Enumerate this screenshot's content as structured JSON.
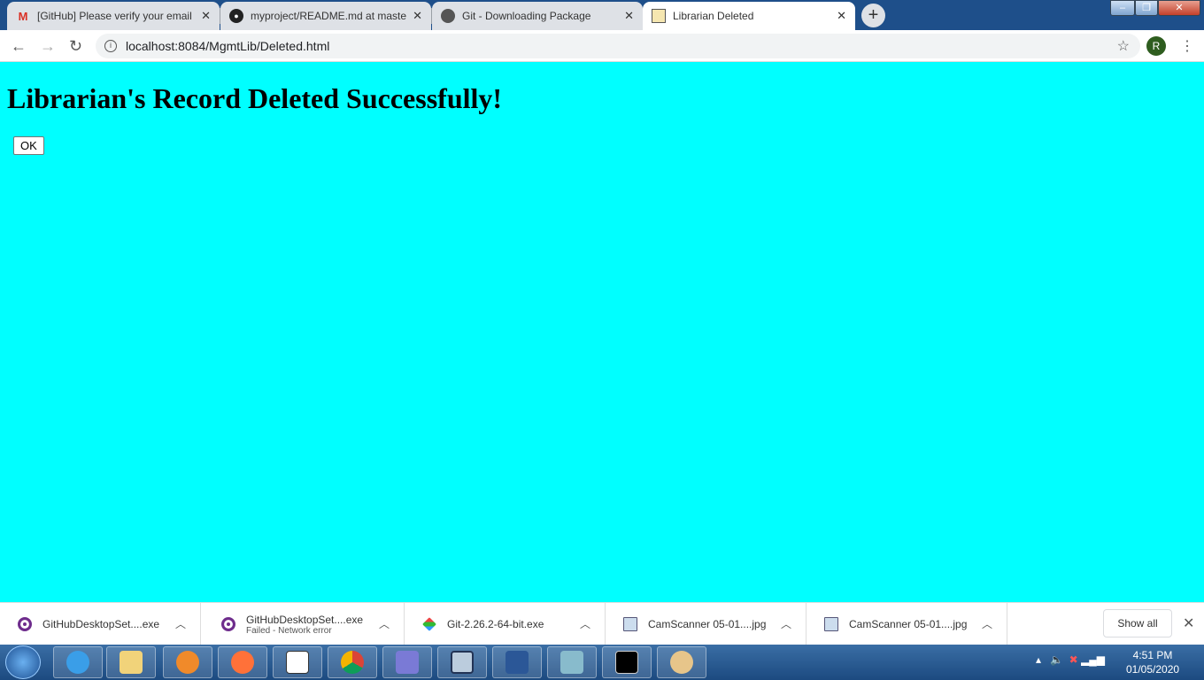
{
  "browser": {
    "tabs": [
      {
        "title": "[GitHub] Please verify your email",
        "icon": "gmail-icon",
        "active": false
      },
      {
        "title": "myproject/README.md at maste",
        "icon": "github-icon",
        "active": false
      },
      {
        "title": "Git - Downloading Package",
        "icon": "globe-icon",
        "active": false
      },
      {
        "title": "Librarian Deleted",
        "icon": "page-favicon-icon",
        "active": true
      }
    ],
    "url": "localhost:8084/MgmtLib/Deleted.html",
    "profile_initial": "R"
  },
  "page": {
    "heading": "Librarian's Record Deleted Successfully!",
    "ok_label": "OK",
    "background": "#00ffff"
  },
  "downloads": {
    "items": [
      {
        "name": "GitHubDesktopSet....exe",
        "status": "",
        "icon": "github-desktop-icon"
      },
      {
        "name": "GitHubDesktopSet....exe",
        "status": "Failed - Network error",
        "icon": "github-desktop-icon"
      },
      {
        "name": "Git-2.26.2-64-bit.exe",
        "status": "",
        "icon": "git-icon"
      },
      {
        "name": "CamScanner 05-01....jpg",
        "status": "",
        "icon": "image-file-icon"
      },
      {
        "name": "CamScanner 05-01....jpg",
        "status": "",
        "icon": "image-file-icon"
      }
    ],
    "show_all": "Show all"
  },
  "taskbar": {
    "time": "4:51 PM",
    "date": "01/05/2020"
  }
}
